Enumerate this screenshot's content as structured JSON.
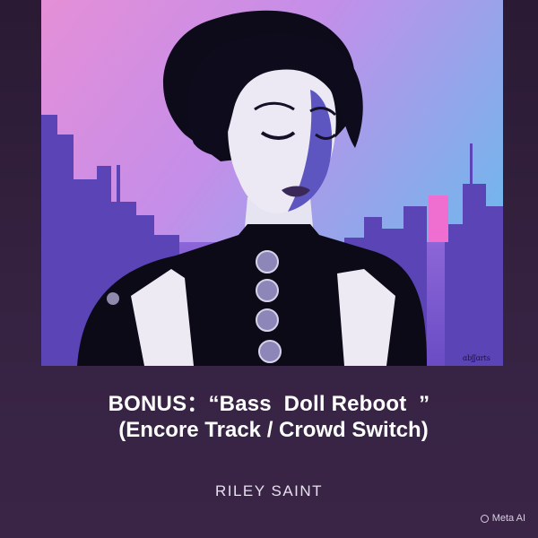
{
  "cover": {
    "signature": "ɑbʃʃɑrts"
  },
  "track": {
    "title_line_1": "BONUS：“Bass  Doll Reboot  ”",
    "title_line_2": "(Encore Track / Crowd Switch)",
    "artist": "RILEY SAINT"
  },
  "watermark": {
    "label": "Meta AI",
    "icon": "meta-ai-ring-icon"
  },
  "colors": {
    "background": "#2f1e3a",
    "sky_top": "#b98ce6",
    "sky_bottom": "#6fb6e8",
    "skyline": "#5a46b8",
    "accent_pink": "#ee6fd0"
  }
}
